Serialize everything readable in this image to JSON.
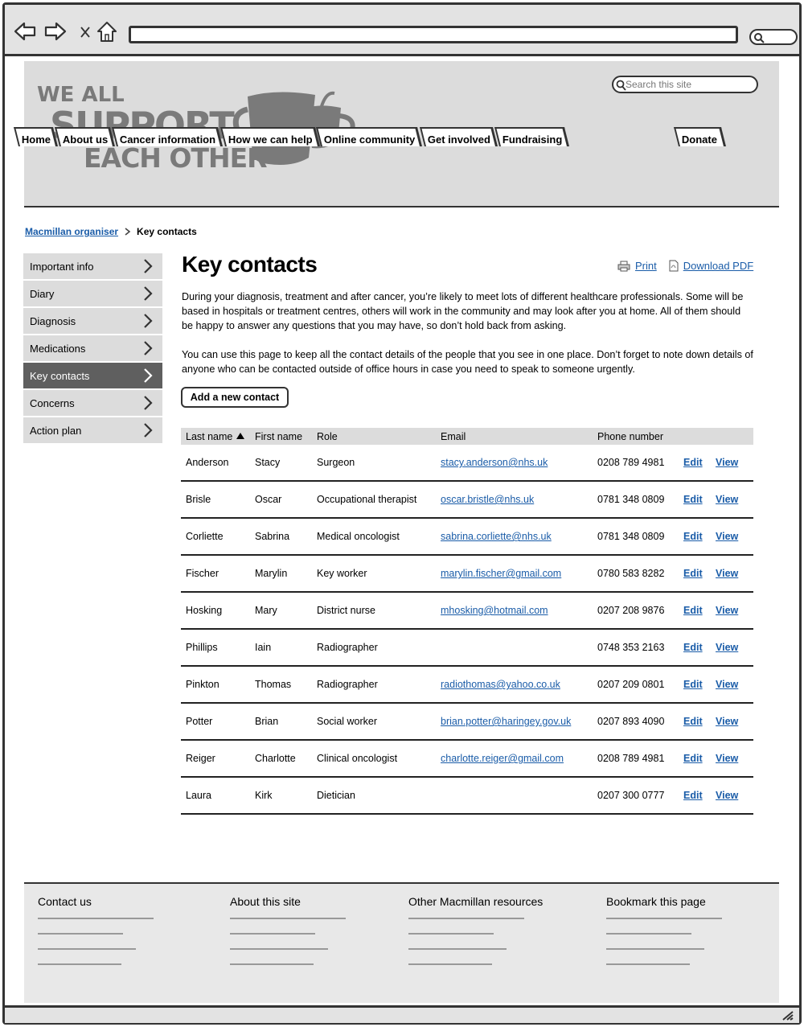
{
  "header": {
    "logo_text_1": "WE ALL",
    "logo_text_2": "SUPPORT",
    "logo_text_3": "EACH OTHER",
    "search_placeholder": "Search this site"
  },
  "nav": {
    "tabs": [
      "Home",
      "About us",
      "Cancer information",
      "How we can help",
      "Online community",
      "Get involved",
      "Fundraising"
    ],
    "donate": "Donate"
  },
  "breadcrumb": {
    "parent": "Macmillan organiser",
    "current": "Key contacts"
  },
  "sidebar": {
    "items": [
      {
        "label": "Important info",
        "active": false
      },
      {
        "label": "Diary",
        "active": false
      },
      {
        "label": "Diagnosis",
        "active": false
      },
      {
        "label": "Medications",
        "active": false
      },
      {
        "label": "Key contacts",
        "active": true
      },
      {
        "label": "Concerns",
        "active": false
      },
      {
        "label": "Action plan",
        "active": false
      }
    ]
  },
  "main": {
    "title": "Key contacts",
    "print_label": "Print",
    "pdf_label": "Download PDF",
    "intro_1": "During your diagnosis, treatment and after cancer, you’re likely to meet lots of different healthcare professionals. Some will be based in hospitals or treatment centres, others will work in the community and may look after you at home. All of them should be happy to answer any questions that you may have, so don’t hold back from asking.",
    "intro_2": "You can use this page to keep all the contact details of the people that you see in one place. Don’t forget to note down details of anyone who can be contacted outside of office hours in case you need to speak to someone urgently.",
    "add_button": "Add a new contact"
  },
  "table": {
    "columns": [
      "Last name",
      "First name",
      "Role",
      "Email",
      "Phone number"
    ],
    "edit_label": "Edit",
    "view_label": "View",
    "rows": [
      {
        "last": "Anderson",
        "first": "Stacy",
        "role": "Surgeon",
        "email": "stacy.anderson@nhs.uk",
        "phone": "0208 789 4981"
      },
      {
        "last": "Brisle",
        "first": "Oscar",
        "role": "Occupational therapist",
        "email": "oscar.bristle@nhs.uk",
        "phone": "0781 348 0809"
      },
      {
        "last": "Corliette",
        "first": "Sabrina",
        "role": "Medical oncologist",
        "email": "sabrina.corliette@nhs.uk",
        "phone": "0781 348 0809"
      },
      {
        "last": "Fischer",
        "first": "Marylin",
        "role": "Key worker",
        "email": "marylin.fischer@gmail.com",
        "phone": "0780 583 8282"
      },
      {
        "last": "Hosking",
        "first": "Mary",
        "role": "District nurse",
        "email": "mhosking@hotmail.com",
        "phone": "0207 208 9876"
      },
      {
        "last": "Phillips",
        "first": "Iain",
        "role": "Radiographer",
        "email": "",
        "phone": "0748 353 2163"
      },
      {
        "last": "Pinkton",
        "first": "Thomas",
        "role": "Radiographer",
        "email": "radiothomas@yahoo.co.uk",
        "phone": "0207 209 0801"
      },
      {
        "last": "Potter",
        "first": "Brian",
        "role": "Social worker",
        "email": "brian.potter@haringey.gov.uk",
        "phone": "0207 893 4090"
      },
      {
        "last": "Reiger",
        "first": "Charlotte",
        "role": "Clinical oncologist",
        "email": "charlotte.reiger@gmail.com",
        "phone": "0208 789 4981"
      },
      {
        "last": "Laura",
        "first": "Kirk",
        "role": "Dietician",
        "email": "",
        "phone": "0207 300 0777"
      }
    ]
  },
  "footer": {
    "columns": [
      "Contact us",
      "About this site",
      "Other Macmillan resources",
      "Bookmark this page"
    ]
  },
  "colors": {
    "link": "#1a5ca8",
    "header_bg": "#dcdcdc",
    "active_sidebar": "#5f5f5f"
  }
}
